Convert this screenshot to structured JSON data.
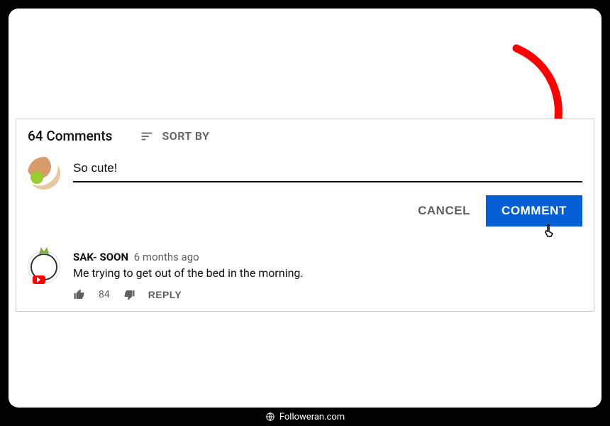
{
  "header": {
    "comments_count_label": "64 Comments",
    "sort_label": "SORT BY"
  },
  "compose": {
    "value": "So cute!",
    "cancel_label": "CANCEL",
    "submit_label": "COMMENT"
  },
  "comments": [
    {
      "author": "SAK- SOON",
      "time": "6 months ago",
      "text": "Me trying to get out of the bed in the morning.",
      "likes": "84",
      "reply_label": "REPLY"
    }
  ],
  "footer": {
    "site": "Followeran.com"
  },
  "colors": {
    "primary": "#065fd4",
    "arrow": "#ff0000"
  }
}
